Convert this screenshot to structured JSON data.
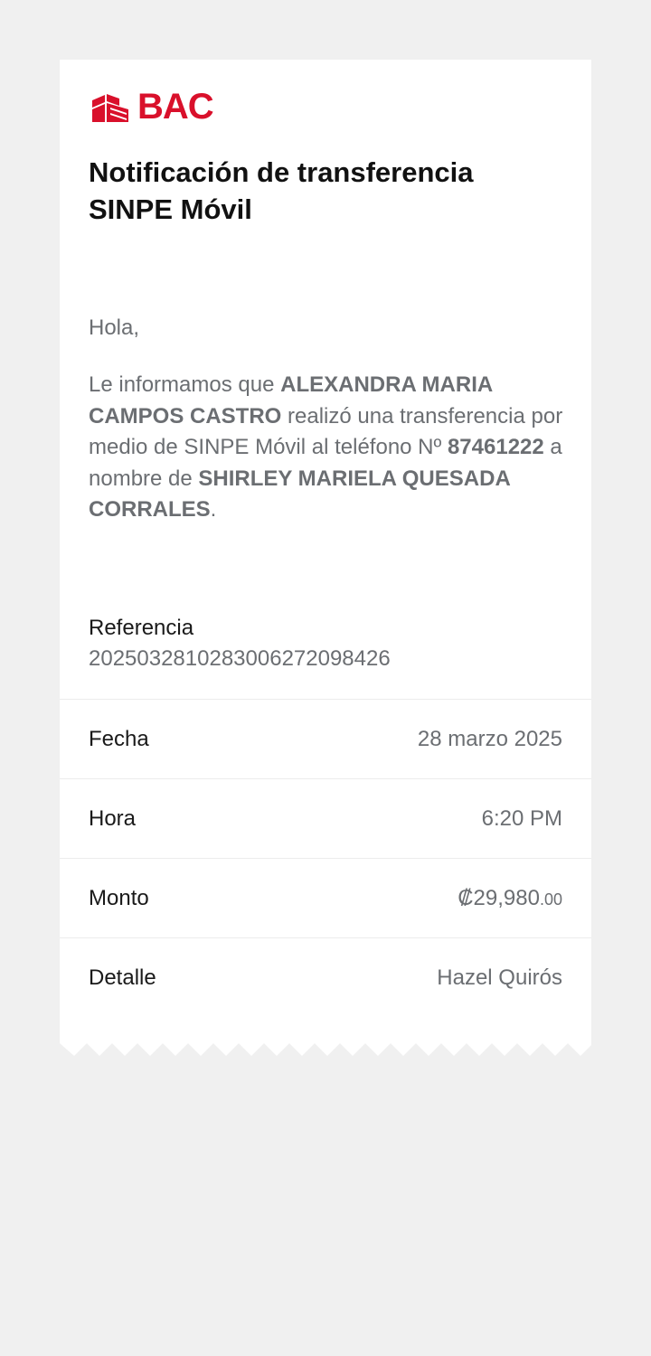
{
  "brand": {
    "name": "BAC",
    "color": "#d9102b",
    "icon": "bac-logo-icon"
  },
  "title": "Notificación de transferencia SINPE Móvil",
  "greeting": "Hola,",
  "message": {
    "p1": "Le informamos que ",
    "sender": "ALEXANDRA MARIA CAMPOS CASTRO",
    "p2": " realizó una transferencia por medio de SINPE Móvil al teléfono Nº ",
    "phone": "87461222",
    "p3": " a nombre de ",
    "recipient": "SHIRLEY MARIELA QUESADA CORRALES",
    "p4": "."
  },
  "reference": {
    "label": "Referencia",
    "value": "2025032810283006272098426"
  },
  "details": {
    "date": {
      "label": "Fecha",
      "value": "28 marzo 2025"
    },
    "time": {
      "label": "Hora",
      "value": "6:20 PM"
    },
    "amount": {
      "label": "Monto",
      "main": "₡29,980",
      "cents": ".00"
    },
    "detail": {
      "label": "Detalle",
      "value": "Hazel Quirós"
    }
  }
}
